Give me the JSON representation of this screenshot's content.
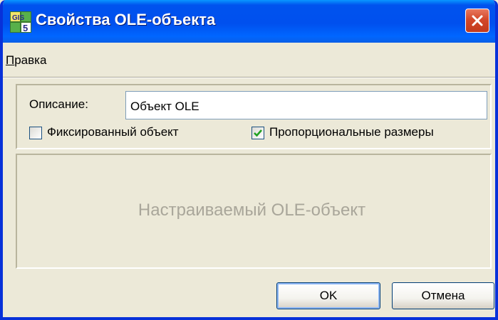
{
  "window": {
    "title": "Свойства OLE-объекта",
    "icon": "gis-app-icon"
  },
  "menu": {
    "items": [
      {
        "underlined": "П",
        "rest": "равка"
      }
    ]
  },
  "form": {
    "description_label": "Описание:",
    "description_value": "Объект OLE",
    "fixed_object": {
      "label": "Фиксированный объект",
      "checked": false
    },
    "proportional_sizes": {
      "label": "Пропорциональные размеры",
      "checked": true
    }
  },
  "preview": {
    "text": "Настраиваемый OLE-объект"
  },
  "buttons": {
    "ok": "OK",
    "cancel": "Отмена"
  },
  "colors": {
    "titlebar": "#0054e3",
    "close": "#d3482a",
    "check": "#21a121"
  }
}
